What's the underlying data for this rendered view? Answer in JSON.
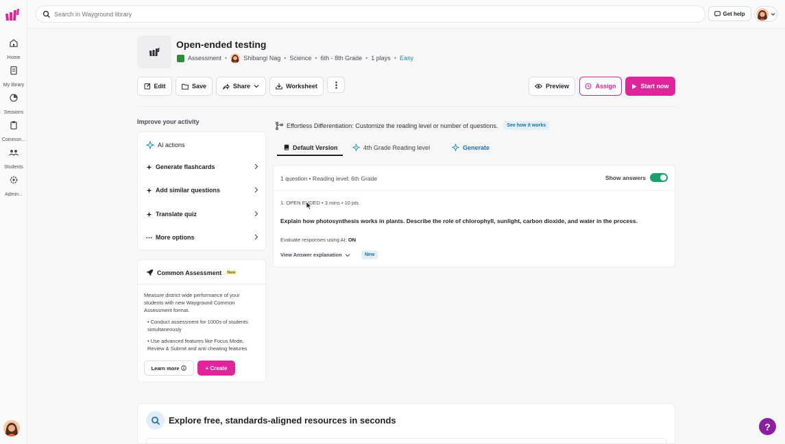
{
  "sidebar": {
    "items": [
      {
        "label": "Home",
        "icon": "home-icon"
      },
      {
        "label": "My library",
        "icon": "library-icon"
      },
      {
        "label": "Sessions",
        "icon": "sessions-icon"
      },
      {
        "label": "Common...",
        "icon": "clipboard-icon"
      },
      {
        "label": "Students",
        "icon": "students-icon"
      },
      {
        "label": "Admin...",
        "icon": "gear-icon"
      }
    ]
  },
  "topbar": {
    "search_placeholder": "Search in Wayground library",
    "help_label": "Get help"
  },
  "header": {
    "title": "Open-ended testing",
    "type": "Assessment",
    "author": "Shibangi Nag",
    "subject": "Science",
    "grade": "6th - 8th Grade",
    "plays": "1 plays",
    "difficulty": "Easy"
  },
  "toolbar": {
    "edit": "Edit",
    "save": "Save",
    "share": "Share",
    "worksheet": "Worksheet",
    "preview": "Preview",
    "assign": "Assign",
    "start": "Start now"
  },
  "improve": {
    "title": "Improve your activity",
    "ai_actions": "AI actions",
    "items": [
      "Generate flashcards",
      "Add similar questions",
      "Translate quiz",
      "More options"
    ]
  },
  "common_assessment": {
    "title": "Common Assessment",
    "badge": "New",
    "description": "Measure district wide performance of your students with new Wayground Common Assessment format.",
    "bullets": [
      "• Conduct assessment for 1000s of students simultaneously",
      "• Use advanced features like Focus Mode, Review & Submit and anti cheating features"
    ],
    "learn_more": "Learn more",
    "create": "+ Create"
  },
  "differentiation": {
    "text": "Effortless Differentiation: Customize the reading level or number of questions.",
    "link": "See how it works"
  },
  "tabs": {
    "default": "Default Version",
    "grade4": "4th Grade Reading level",
    "generate": "Generate"
  },
  "questions": {
    "summary": "1 question  • Reading level: 6th Grade",
    "show_answers": "Show answers",
    "show_answers_on": true,
    "meta": "1. OPEN ENDED  •  3 mins  •  10 pts",
    "text": "Explain how photosynthesis works in plants. Describe the role of chlorophyll, sunlight, carbon dioxide, and water in the process.",
    "eval_label": "Evaluate responses using AI:",
    "eval_value": "ON",
    "explanation": "View Answer explanation",
    "badge": "New"
  },
  "explore": {
    "title": "Explore free, standards-aligned resources in seconds"
  },
  "help_fab": "?",
  "colors": {
    "brand": "#e0249b",
    "accent_blue": "#1a6fa8",
    "toggle_on": "#1aa06a",
    "fab": "#8a1fa3"
  }
}
